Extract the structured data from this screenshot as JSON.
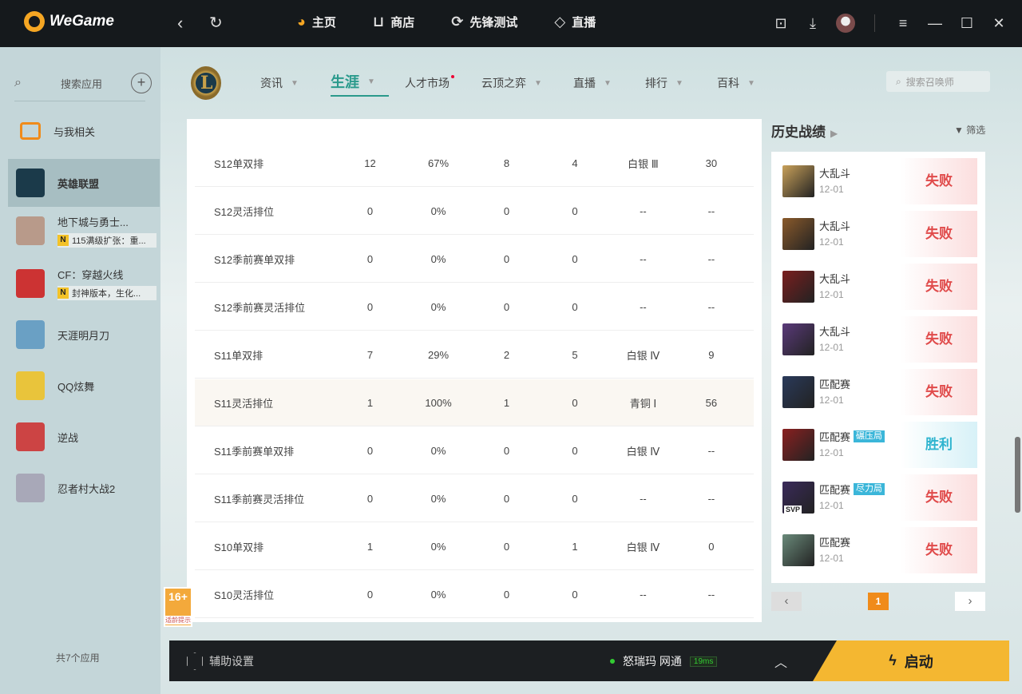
{
  "app": {
    "name": "WeGame"
  },
  "topnav": [
    {
      "label": "主页",
      "icon": "home-icon"
    },
    {
      "label": "商店",
      "icon": "shop-icon"
    },
    {
      "label": "先锋测试",
      "icon": "test-icon"
    },
    {
      "label": "直播",
      "icon": "live-icon"
    }
  ],
  "sidebar": {
    "search_label": "搜索应用",
    "items": [
      {
        "name": "与我相关",
        "icon_color": "#f08b1a"
      },
      {
        "name": "英雄联盟",
        "active": true
      },
      {
        "name": "地下城与勇士...",
        "sub": "115满级扩张：重..."
      },
      {
        "name": "CF：穿越火线",
        "sub": "封神版本，生化..."
      },
      {
        "name": "天涯明月刀"
      },
      {
        "name": "QQ炫舞"
      },
      {
        "name": "逆战"
      },
      {
        "name": "忍者村大战2"
      }
    ],
    "total": "共7个应用"
  },
  "subnav": [
    {
      "label": "资讯"
    },
    {
      "label": "生涯",
      "active": true
    },
    {
      "label": "人才市场"
    },
    {
      "label": "云顶之弈"
    },
    {
      "label": "直播"
    },
    {
      "label": "排行"
    },
    {
      "label": "百科"
    }
  ],
  "summoner_search": {
    "placeholder": "搜索召唤师"
  },
  "seasons": [
    [
      "S12单双排",
      "12",
      "67%",
      "8",
      "4",
      "白银 Ⅲ",
      "30"
    ],
    [
      "S12灵活排位",
      "0",
      "0%",
      "0",
      "0",
      "--",
      "--"
    ],
    [
      "S12季前赛单双排",
      "0",
      "0%",
      "0",
      "0",
      "--",
      "--"
    ],
    [
      "S12季前赛灵活排位",
      "0",
      "0%",
      "0",
      "0",
      "--",
      "--"
    ],
    [
      "S11单双排",
      "7",
      "29%",
      "2",
      "5",
      "白银 Ⅳ",
      "9"
    ],
    [
      "S11灵活排位",
      "1",
      "100%",
      "1",
      "0",
      "青铜 Ⅰ",
      "56"
    ],
    [
      "S11季前赛单双排",
      "0",
      "0%",
      "0",
      "0",
      "白银 Ⅳ",
      "--"
    ],
    [
      "S11季前赛灵活排位",
      "0",
      "0%",
      "0",
      "0",
      "--",
      "--"
    ],
    [
      "S10单双排",
      "1",
      "0%",
      "0",
      "1",
      "白银 Ⅳ",
      "0"
    ],
    [
      "S10灵活排位",
      "0",
      "0%",
      "0",
      "0",
      "--",
      "--"
    ]
  ],
  "age_badge": {
    "age": "16+",
    "label": "适龄提示"
  },
  "history": {
    "title": "历史战绩",
    "filter": "筛选",
    "matches": [
      {
        "mode": "大乱斗",
        "date": "12-01",
        "result": "失败",
        "win": false,
        "tag": "",
        "color": "#c9a15a"
      },
      {
        "mode": "大乱斗",
        "date": "12-01",
        "result": "失败",
        "win": false,
        "tag": "",
        "color": "#8a5a2b"
      },
      {
        "mode": "大乱斗",
        "date": "12-01",
        "result": "失败",
        "win": false,
        "tag": "",
        "color": "#7a1f1f"
      },
      {
        "mode": "大乱斗",
        "date": "12-01",
        "result": "失败",
        "win": false,
        "tag": "",
        "color": "#5a3a7a"
      },
      {
        "mode": "匹配赛",
        "date": "12-01",
        "result": "失败",
        "win": false,
        "tag": "",
        "color": "#2a3a5a"
      },
      {
        "mode": "匹配赛",
        "date": "12-01",
        "result": "胜利",
        "win": true,
        "tag": "碾压局",
        "color": "#8a2020"
      },
      {
        "mode": "匹配赛",
        "date": "12-01",
        "result": "失败",
        "win": false,
        "tag": "尽力局",
        "color": "#3a2a5a",
        "badge": "SVP"
      },
      {
        "mode": "匹配赛",
        "date": "12-01",
        "result": "失败",
        "win": false,
        "tag": "",
        "color": "#6a8a7a"
      }
    ],
    "page": "1"
  },
  "bottom": {
    "assist": "辅助设置",
    "server": "怒瑞玛 网通",
    "ping": "19ms",
    "launch": "启动"
  }
}
